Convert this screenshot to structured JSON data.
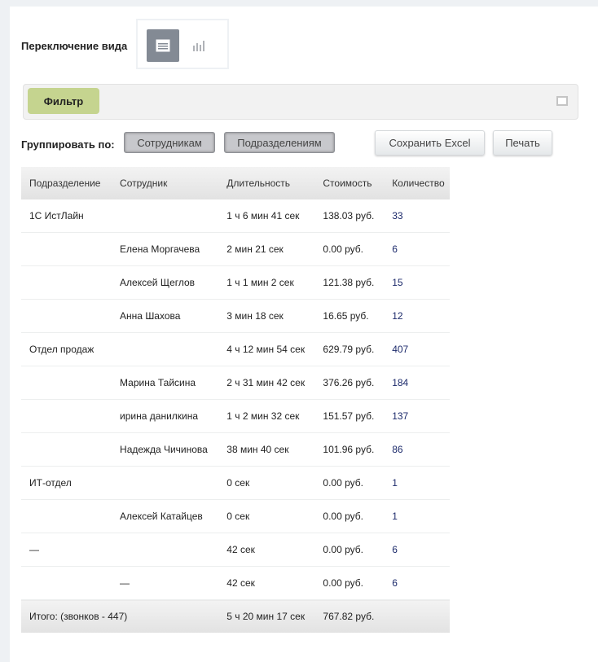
{
  "view_switch": {
    "label": "Переключение вида",
    "table_icon": "table-view-icon",
    "chart_icon": "bar-chart-icon"
  },
  "filter": {
    "label": "Фильтр"
  },
  "group": {
    "label": "Группировать по:",
    "by_employees": "Сотрудникам",
    "by_departments": "Подразделениям"
  },
  "actions": {
    "save_excel": "Сохранить Excel",
    "print": "Печать"
  },
  "table": {
    "headers": [
      "Подразделение",
      "Сотрудник",
      "Длительность",
      "Стоимость",
      "Количество"
    ],
    "rows": [
      [
        "1С ИстЛайн",
        "",
        "1 ч 6 мин 41 сек",
        "138.03 руб.",
        "33"
      ],
      [
        "",
        "Елена Моргачева",
        "2 мин 21 сек",
        "0.00 руб.",
        "6"
      ],
      [
        "",
        "Алексей Щеглов",
        "1 ч 1 мин 2 сек",
        "121.38 руб.",
        "15"
      ],
      [
        "",
        "Анна Шахова",
        "3 мин 18 сек",
        "16.65 руб.",
        "12"
      ],
      [
        "Отдел продаж",
        "",
        "4 ч 12 мин 54 сек",
        "629.79 руб.",
        "407"
      ],
      [
        "",
        "Марина Тайсина",
        "2 ч 31 мин 42 сек",
        "376.26 руб.",
        "184"
      ],
      [
        "",
        "ирина данилкина",
        "1 ч 2 мин 32 сек",
        "151.57 руб.",
        "137"
      ],
      [
        "",
        "Надежда Чичинова",
        "38 мин 40 сек",
        "101.96 руб.",
        "86"
      ],
      [
        "ИТ-отдел",
        "",
        "0 сек",
        "0.00 руб.",
        "1"
      ],
      [
        "",
        "Алексей Катайцев",
        "0 сек",
        "0.00 руб.",
        "1"
      ],
      [
        "—",
        "",
        "42 сек",
        "0.00 руб.",
        "6"
      ],
      [
        "",
        "—",
        "42 сек",
        "0.00 руб.",
        "6"
      ]
    ],
    "total": {
      "label": "Итого: (звонков - 447)",
      "duration": "5 ч 20 мин 17 сек",
      "cost": "767.82 руб."
    }
  }
}
